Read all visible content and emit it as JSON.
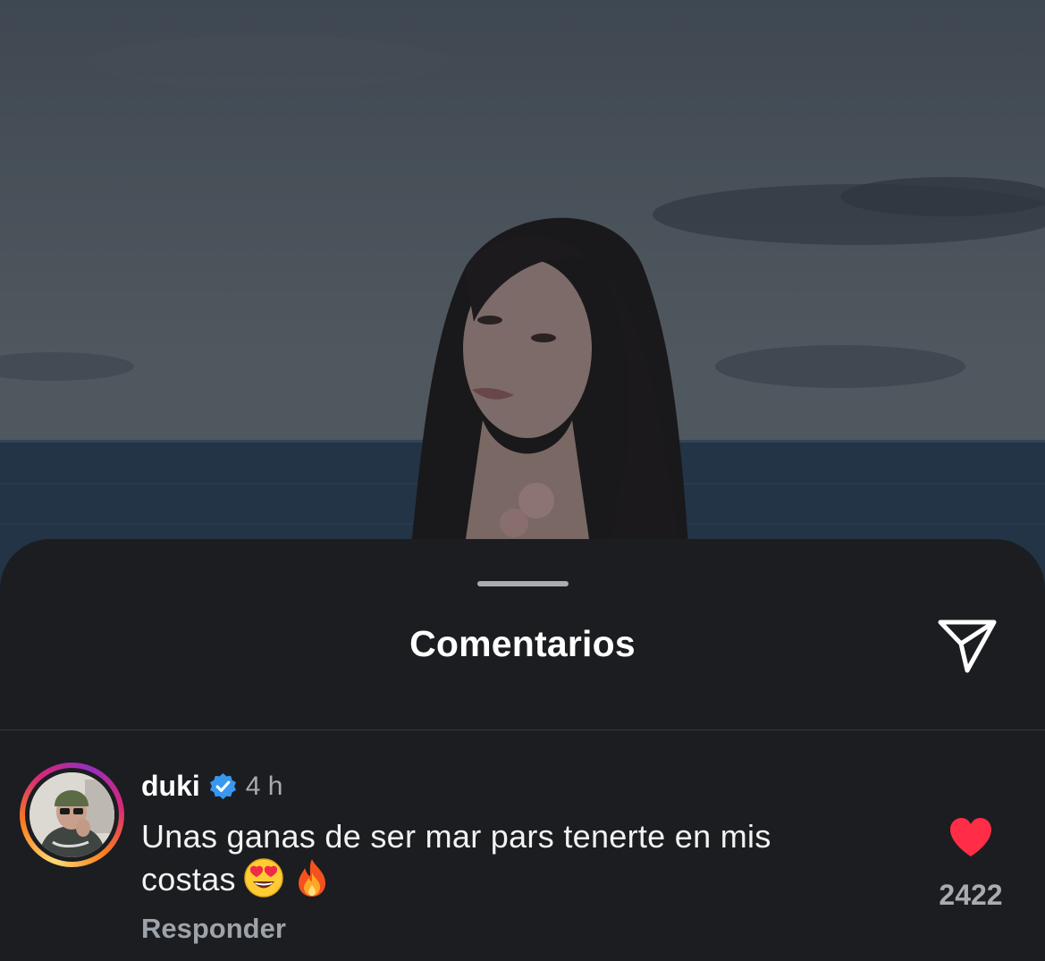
{
  "sheet": {
    "title": "Comentarios",
    "share_icon": "paper-plane-icon"
  },
  "comment": {
    "username": "duki",
    "verified": true,
    "time": "4 h",
    "text": "Unas ganas de ser mar pars tenerte en mis costas",
    "emojis": [
      "heart-eyes-emoji",
      "fire-emoji"
    ],
    "reply_label": "Responder",
    "likes": "2422",
    "liked": true
  },
  "colors": {
    "sheet_background": "#1b1d21",
    "like_red": "#ff2d45",
    "verified_blue": "#3897f0",
    "muted_text": "#a8acb2"
  }
}
